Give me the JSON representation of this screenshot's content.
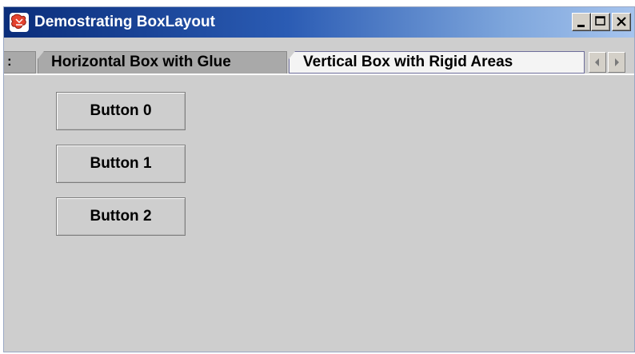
{
  "window": {
    "title": "Demostrating BoxLayout",
    "controls": {
      "minimize": "minimize-icon",
      "maximize": "maximize-icon",
      "close": "close-icon"
    },
    "titlebar_colors": {
      "start": "#0a2d7a",
      "end": "#a6c4ee"
    }
  },
  "tabs": [
    {
      "label": ":",
      "selected": false
    },
    {
      "label": "Horizontal Box with Glue",
      "selected": false
    },
    {
      "label": "Vertical Box with Rigid Areas",
      "selected": true
    }
  ],
  "tab_scroll": {
    "left": "arrow-left-icon",
    "right": "arrow-right-icon"
  },
  "buttons": [
    "Button 0",
    "Button 1",
    "Button 2"
  ],
  "colors": {
    "panel": "#cecece",
    "selected_tab": "#f4f4f4",
    "unselected_tab": "#a9a9a9"
  }
}
